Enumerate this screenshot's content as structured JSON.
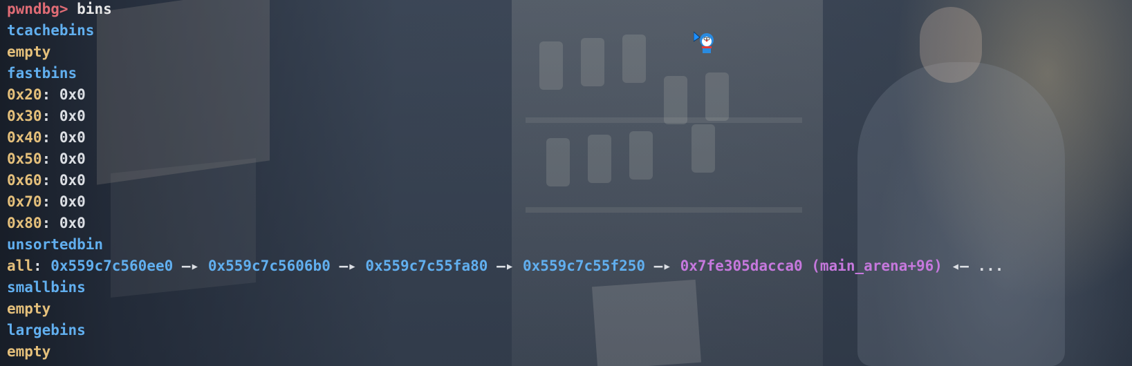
{
  "terminal": {
    "prompt": "pwndbg>",
    "command": " bins",
    "tcache_header": "tcachebins",
    "tcache_status": "empty",
    "fastbins_header": "fastbins",
    "fastbins": [
      {
        "size": "0x20",
        "value": "0x0"
      },
      {
        "size": "0x30",
        "value": "0x0"
      },
      {
        "size": "0x40",
        "value": "0x0"
      },
      {
        "size": "0x50",
        "value": "0x0"
      },
      {
        "size": "0x60",
        "value": "0x0"
      },
      {
        "size": "0x70",
        "value": "0x0"
      },
      {
        "size": "0x80",
        "value": "0x0"
      }
    ],
    "fast_sep": ": ",
    "unsorted_header": "unsortedbin",
    "unsorted": {
      "label": "all",
      "sep": ": ",
      "chain": [
        "0x559c7c560ee0",
        "0x559c7c5606b0",
        "0x559c7c55fa80",
        "0x559c7c55f250"
      ],
      "arrow": " —▸ ",
      "arena": "0x7fe305dacca0 (main_arena+96)",
      "back_arrow": " ◂— ",
      "ellipsis": "..."
    },
    "small_header": "smallbins",
    "small_status": "empty",
    "large_header": "largebins",
    "large_status": "empty"
  },
  "colors": {
    "prompt": "#e06c75",
    "header": "#61afef",
    "size_label": "#e5c07b",
    "arena": "#c678dd"
  },
  "icons": {
    "cursor": "doraemon-cursor-icon"
  }
}
